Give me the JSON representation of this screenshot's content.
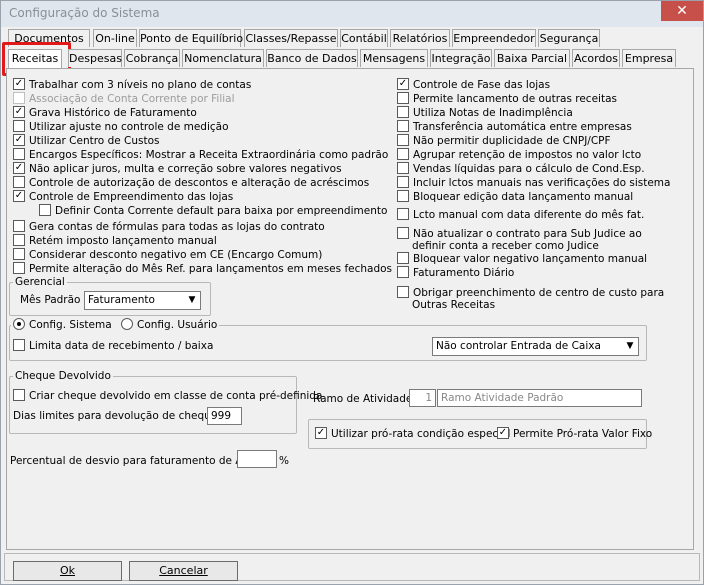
{
  "window": {
    "title": "Configuração do Sistema",
    "close_label": "✕"
  },
  "tabs_row1": [
    "Documentos",
    "On-line",
    "Ponto de Equilíbrio",
    "Classes/Repasse",
    "Contábil",
    "Relatórios",
    "Empreendedor",
    "Segurança"
  ],
  "tabs_row2": [
    "Receitas",
    "Despesas",
    "Cobrança",
    "Nomenclatura",
    "Banco de Dados",
    "Mensagens",
    "Integração",
    "Baixa Parcial",
    "Acordos",
    "Empresa"
  ],
  "left_options": [
    {
      "label": "Trabalhar com 3 níveis no plano de contas",
      "checked": true,
      "enabled": true
    },
    {
      "label": "Associação de Conta Corrente por Filial",
      "checked": false,
      "enabled": false
    },
    {
      "label": "Grava Histórico de Faturamento",
      "checked": true,
      "enabled": true
    },
    {
      "label": "Utilizar ajuste no controle de medição",
      "checked": false,
      "enabled": true
    },
    {
      "label": "Utilizar Centro de Custos",
      "checked": true,
      "enabled": true
    },
    {
      "label": "Encargos Específicos: Mostrar a Receita Extraordinária como padrão",
      "checked": false,
      "enabled": true
    },
    {
      "label": "Não aplicar juros, multa e correção sobre valores negativos",
      "checked": true,
      "enabled": true
    },
    {
      "label": "Controle de autorização de descontos e alteração de acréscimos",
      "checked": false,
      "enabled": true
    },
    {
      "label": "Controle de Empreendimento das lojas",
      "checked": true,
      "enabled": true
    },
    {
      "label": "Definir Conta Corrente default para baixa por empreendimento",
      "checked": false,
      "enabled": true
    },
    {
      "label": "Gera contas de fórmulas para todas as lojas do contrato",
      "checked": false,
      "enabled": true
    },
    {
      "label": "Retém imposto lançamento manual",
      "checked": false,
      "enabled": true
    },
    {
      "label": "Considerar desconto negativo em CE (Encargo Comum)",
      "checked": false,
      "enabled": true
    },
    {
      "label": "Permite alteração do Mês Ref. para lançamentos em meses fechados",
      "checked": false,
      "enabled": true
    }
  ],
  "right_options": [
    {
      "label": "Controle de Fase das lojas",
      "checked": true
    },
    {
      "label": "Permite lancamento de outras receitas",
      "checked": false
    },
    {
      "label": "Utiliza Notas de Inadimplência",
      "checked": false
    },
    {
      "label": "Transferência automática entre empresas",
      "checked": false
    },
    {
      "label": "Não permitir duplicidade de CNPJ/CPF",
      "checked": false
    },
    {
      "label": "Agrupar retenção de impostos no valor lcto",
      "checked": false
    },
    {
      "label": "Vendas líquidas para o cálculo de Cond.Esp.",
      "checked": false
    },
    {
      "label": "Incluir lctos manuais nas verificações do sistema",
      "checked": false
    },
    {
      "label": "Bloquear edição data lançamento manual",
      "checked": false
    },
    {
      "label": "Lcto manual com data diferente do mês fat.",
      "checked": false
    },
    {
      "label": "Não atualizar o contrato para Sub Judice ao",
      "label2": "definir conta a receber como Judice",
      "checked": false
    },
    {
      "label": "Bloquear valor negativo lançamento manual",
      "checked": false
    },
    {
      "label": "Faturamento Diário",
      "checked": false
    },
    {
      "label": "Obrigar preenchimento de centro de custo para",
      "label2": "Outras Receitas",
      "checked": false
    }
  ],
  "gerencial": {
    "title": "Gerencial",
    "mes_label": "Mês Padrão",
    "mes_value": "Faturamento"
  },
  "config": {
    "radio1": "Config. Sistema",
    "radio2": "Config. Usuário",
    "selected": "Config. Sistema",
    "limita_label": "Limita data de recebimento / baixa",
    "limita_checked": false,
    "caixa_value": "Não controlar Entrada de Caixa"
  },
  "cheque": {
    "title": "Cheque Devolvido",
    "criar_label": "Criar cheque devolvido em classe de conta pré-definida",
    "criar_checked": false,
    "dias_label": "Dias limites para devolução de cheques",
    "dias_value": "999"
  },
  "ramo": {
    "label": "Ramo de Atividade:",
    "code": "1",
    "value": "Ramo Atividade Padrão"
  },
  "prorata": {
    "label1": "Utilizar pró-rata condição especial",
    "checked1": true,
    "label2": "Permite Pró-rata Valor Fixo",
    "checked2": true
  },
  "amm": {
    "label": "Percentual de desvio para faturamento de AMM",
    "value": "",
    "unit": "%"
  },
  "buttons": {
    "ok": "Ok",
    "cancel": "Cancelar"
  },
  "colors": {
    "highlight": "#e0191b"
  }
}
